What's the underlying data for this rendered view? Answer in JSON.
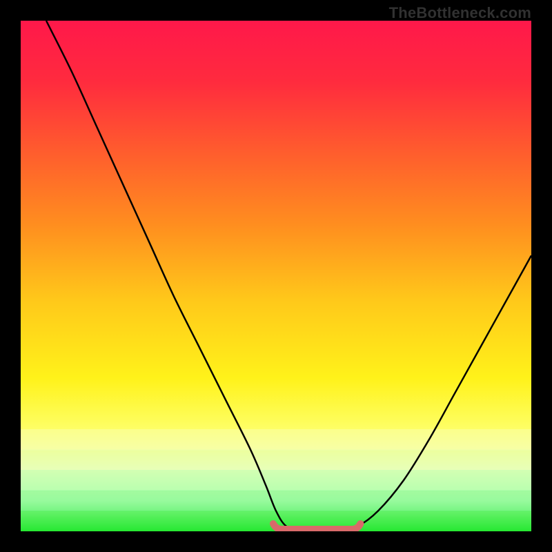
{
  "watermark": "TheBottleneck.com",
  "colors": {
    "frame": "#000000",
    "watermark": "#313131",
    "curve": "#000000",
    "flat_segment": "#d96a6a",
    "baseline": "#27e833",
    "gradient_stops": [
      {
        "offset": 0.0,
        "color": "#ff184a"
      },
      {
        "offset": 0.12,
        "color": "#ff2b3e"
      },
      {
        "offset": 0.25,
        "color": "#ff5a2e"
      },
      {
        "offset": 0.4,
        "color": "#ff8e1f"
      },
      {
        "offset": 0.55,
        "color": "#ffc91a"
      },
      {
        "offset": 0.7,
        "color": "#fff21a"
      },
      {
        "offset": 0.8,
        "color": "#feff66"
      },
      {
        "offset": 0.88,
        "color": "#f1ffb7"
      },
      {
        "offset": 0.94,
        "color": "#b8ffb0"
      },
      {
        "offset": 1.0,
        "color": "#27e833"
      }
    ]
  },
  "chart_data": {
    "type": "line",
    "title": "",
    "xlabel": "",
    "ylabel": "",
    "xlim": [
      0,
      100
    ],
    "ylim": [
      0,
      100
    ],
    "series": [
      {
        "name": "bottleneck-curve",
        "x": [
          5,
          10,
          15,
          20,
          25,
          30,
          35,
          40,
          45,
          48,
          50,
          52,
          55,
          58,
          60,
          62,
          66,
          70,
          75,
          80,
          85,
          90,
          95,
          100
        ],
        "y": [
          100,
          90,
          79,
          68,
          57,
          46,
          36,
          26,
          16,
          9,
          4,
          1,
          0,
          0,
          0,
          0,
          1,
          4,
          10,
          18,
          27,
          36,
          45,
          54
        ]
      }
    ],
    "flat_segment": {
      "x_start": 50,
      "x_end": 66,
      "y": 0
    },
    "baseline_y": 0
  }
}
